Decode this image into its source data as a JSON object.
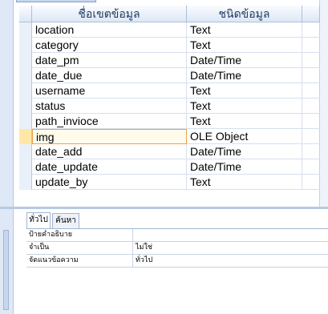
{
  "grid": {
    "header": {
      "field_name": "ชื่อเขตข้อมูล",
      "data_type": "ชนิดข้อมูล"
    },
    "fields": [
      {
        "name": "location",
        "type": "Text"
      },
      {
        "name": "category",
        "type": "Text"
      },
      {
        "name": "date_pm",
        "type": "Date/Time"
      },
      {
        "name": "date_due",
        "type": "Date/Time"
      },
      {
        "name": "username",
        "type": "Text"
      },
      {
        "name": "status",
        "type": "Text"
      },
      {
        "name": "path_invioce",
        "type": "Text"
      },
      {
        "name": "img",
        "type": "OLE Object",
        "current": true
      },
      {
        "name": "date_add",
        "type": "Date/Time"
      },
      {
        "name": "date_update",
        "type": "Date/Time"
      },
      {
        "name": "update_by",
        "type": "Text"
      }
    ]
  },
  "properties": {
    "tabs": [
      "ทั่วไป",
      "ค้นหา"
    ],
    "rows": [
      {
        "label": "ป้ายคำอธิบาย",
        "value": ""
      },
      {
        "label": "จำเป็น",
        "value": "ไม่ใช่"
      },
      {
        "label": "จัดแนวข้อความ",
        "value": "ทั่วไป"
      }
    ]
  },
  "colors": {
    "header_text": "#1f3a63",
    "current_row_border": "#f0a040",
    "accent": "#dfe8f6"
  }
}
